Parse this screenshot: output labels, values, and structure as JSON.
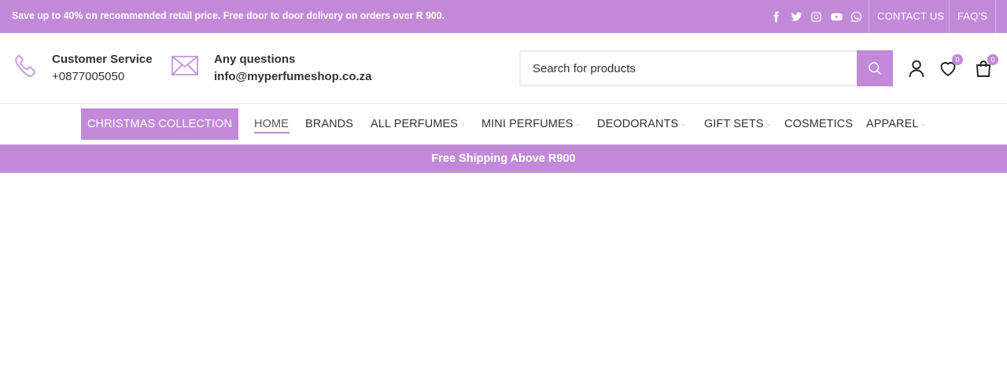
{
  "topbar": {
    "promo_text": "Save up to 40% on recommended retail price. Free door to door delivery on orders over R 900.",
    "social_icons": [
      "facebook-icon",
      "twitter-icon",
      "instagram-icon",
      "youtube-icon",
      "whatsapp-icon"
    ],
    "contact_link": "CONTACT US",
    "faq_link": "FAQ'S",
    "background_color": "#c289d9"
  },
  "header": {
    "customer_service": {
      "title": "Customer Service",
      "phone": "+0877005050",
      "icon": "phone-icon"
    },
    "questions": {
      "title": "Any questions",
      "email": "info@myperfumeshop.co.za",
      "icon": "envelope-icon"
    },
    "search": {
      "placeholder": "Search for products",
      "icon": "search-icon"
    },
    "account_icon": "user-icon",
    "wishlist": {
      "icon": "heart-icon",
      "count": "0"
    },
    "cart": {
      "icon": "shopping-bag-icon",
      "count": "0"
    }
  },
  "nav": {
    "promo_button": "CHRISTMAS COLLECTION",
    "items": [
      {
        "label": "HOME",
        "dropdown": false,
        "active": true
      },
      {
        "label": "BRANDS",
        "dropdown": false
      },
      {
        "label": "ALL PERFUMES",
        "dropdown": true
      },
      {
        "label": "MINI PERFUMES",
        "dropdown": true
      },
      {
        "label": "DEODORANTS",
        "dropdown": true
      },
      {
        "label": "GIFT SETS",
        "dropdown": true
      },
      {
        "label": "COSMETICS",
        "dropdown": false
      },
      {
        "label": "APPAREL",
        "dropdown": true
      }
    ],
    "chevron": "⌄"
  },
  "shipping_bar": {
    "text": "Free Shipping Above R900"
  }
}
